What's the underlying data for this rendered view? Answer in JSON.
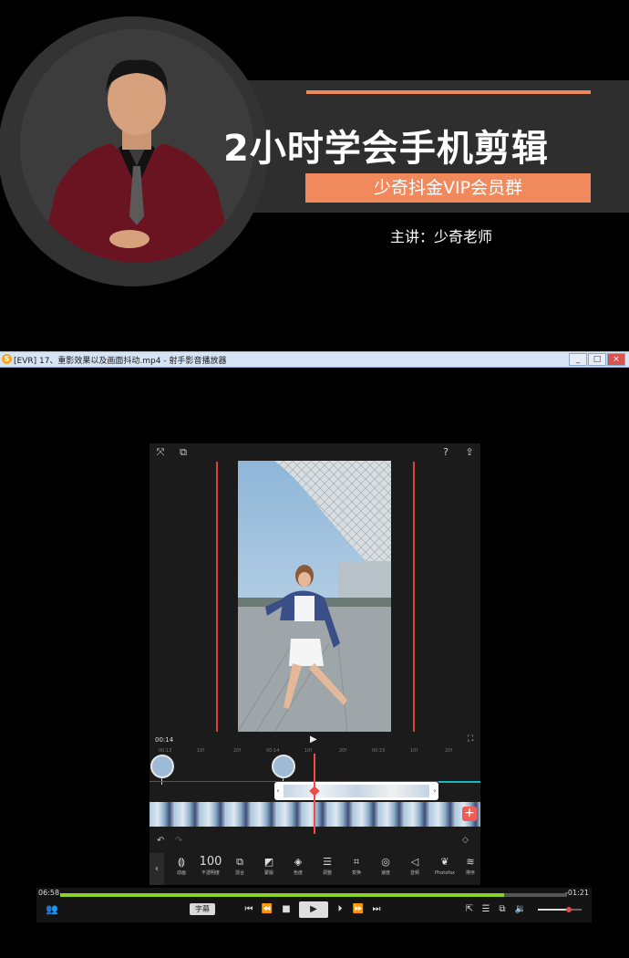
{
  "banner": {
    "title": "2小时学会手机剪辑",
    "badge": "少奇抖金VIP会员群",
    "speaker": "主讲：少奇老师"
  },
  "window": {
    "title": "[EVR] 17、重影效果以及画面抖动.mp4 - 射手影音播放器",
    "buttons": [
      "_",
      "□",
      "×"
    ]
  },
  "app": {
    "top_icons": [
      "crop-icon",
      "copy-icon",
      "help-icon",
      "share-icon"
    ],
    "current_time": "00:14",
    "ruler_labels": [
      "00:13",
      "10f",
      "20f",
      "00:14",
      "10f",
      "20f",
      "00:15",
      "10f",
      "20f"
    ],
    "toolbar": [
      {
        "glyph": "⟬⟭",
        "label": "动画"
      },
      {
        "glyph": "100",
        "label": "不透明度"
      },
      {
        "glyph": "⧉",
        "label": "混合"
      },
      {
        "glyph": "◩",
        "label": "蒙版"
      },
      {
        "glyph": "◈",
        "label": "色度"
      },
      {
        "glyph": "☰",
        "label": "调整"
      },
      {
        "glyph": "⌗",
        "label": "变换"
      },
      {
        "glyph": "◎",
        "label": "速度"
      },
      {
        "glyph": "◁",
        "label": "音频"
      },
      {
        "glyph": "❦",
        "label": "Photofox"
      },
      {
        "glyph": "≋",
        "label": "排序"
      }
    ],
    "add_label": "+",
    "back_label": "‹"
  },
  "player": {
    "elapsed": "06:58",
    "remaining": "-01:21",
    "progress": 0.875,
    "volume": 0.7,
    "subtitle_label": "字幕",
    "progress_color": "#8bd22b"
  },
  "colors": {
    "accent": "#f08a5d",
    "guide": "#d9413b",
    "playhead": "#f04a4a"
  }
}
